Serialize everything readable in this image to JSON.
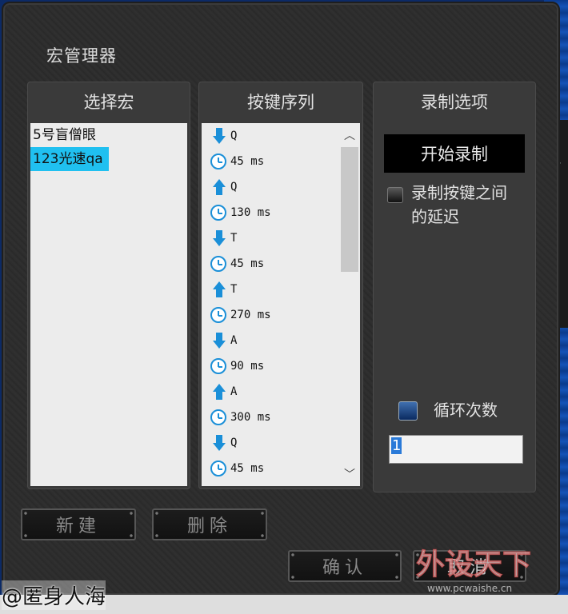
{
  "window": {
    "title": "宏管理器"
  },
  "panels": {
    "select_macro": {
      "header": "选择宏",
      "items": [
        {
          "label": "5号盲僧眼",
          "selected": false
        },
        {
          "label": "123光速qa",
          "selected": true
        }
      ]
    },
    "key_sequence": {
      "header": "按键序列",
      "rows": [
        {
          "kind": "down",
          "text": "Q"
        },
        {
          "kind": "delay",
          "text": "45 ms"
        },
        {
          "kind": "up",
          "text": "Q"
        },
        {
          "kind": "delay",
          "text": "130 ms"
        },
        {
          "kind": "down",
          "text": "T"
        },
        {
          "kind": "delay",
          "text": "45 ms"
        },
        {
          "kind": "up",
          "text": "T"
        },
        {
          "kind": "delay",
          "text": "270 ms"
        },
        {
          "kind": "down",
          "text": "A"
        },
        {
          "kind": "delay",
          "text": "90 ms"
        },
        {
          "kind": "up",
          "text": "A"
        },
        {
          "kind": "delay",
          "text": "300 ms"
        },
        {
          "kind": "down",
          "text": "Q"
        },
        {
          "kind": "delay",
          "text": "45 ms"
        }
      ]
    },
    "record_options": {
      "header": "录制选项",
      "start_button": "开始录制",
      "record_delay_label_line1": "录制按键之间",
      "record_delay_label_line2": "的延迟",
      "loop_label": "循环次数",
      "loop_value": "1"
    }
  },
  "buttons": {
    "new": "新建",
    "delete": "删除",
    "confirm": "确认",
    "cancel": "取消"
  },
  "watermark": {
    "user": "@匿身人海",
    "site_logo": "外设天下",
    "site_url": "www.pcwaishe.cn"
  },
  "colors": {
    "selection": "#20c0f0",
    "accent_icon": "#1a8fd8"
  }
}
